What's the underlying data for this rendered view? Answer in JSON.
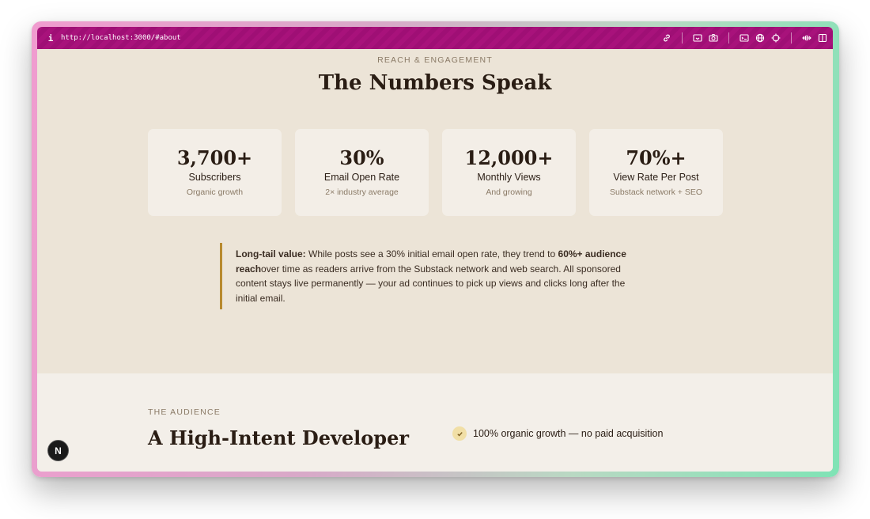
{
  "toolbar": {
    "info_icon_text": "i",
    "url": "http://localhost:3000/#about",
    "icons": [
      "link-icon",
      "screenshot-area-icon",
      "camera-icon",
      "terminal-icon",
      "globe-icon",
      "crosshair-icon",
      "resize-arrows-icon",
      "sidebar-icon"
    ]
  },
  "reach": {
    "eyebrow": "REACH & ENGAGEMENT",
    "title": "The Numbers Speak",
    "stats": [
      {
        "value": "3,700+",
        "label": "Subscribers",
        "sub": "Organic growth"
      },
      {
        "value": "30%",
        "label": "Email Open Rate",
        "sub": "2× industry average"
      },
      {
        "value": "12,000+",
        "label": "Monthly Views",
        "sub": "And growing"
      },
      {
        "value": "70%+",
        "label": "View Rate Per Post",
        "sub": "Substack network + SEO"
      }
    ],
    "quote": {
      "lead": "Long-tail value:",
      "text1": " While posts see a 30% initial email open rate, they trend to ",
      "bold": "60%+ audience reach",
      "text2": "over time as readers arrive from the Substack network and web search. All sponsored content stays live permanently — your ad continues to pick up views and clicks long after the initial email."
    }
  },
  "audience": {
    "eyebrow": "THE AUDIENCE",
    "title": "A High-Intent Developer",
    "checks": [
      "100% organic growth — no paid acquisition"
    ]
  },
  "badge": {
    "letter": "N"
  },
  "colors": {
    "toolbar": "#a8127b",
    "background": "#ece4d7",
    "card": "#f3eee7",
    "accent_border": "#b88a2f",
    "heading": "#2a1d14"
  }
}
